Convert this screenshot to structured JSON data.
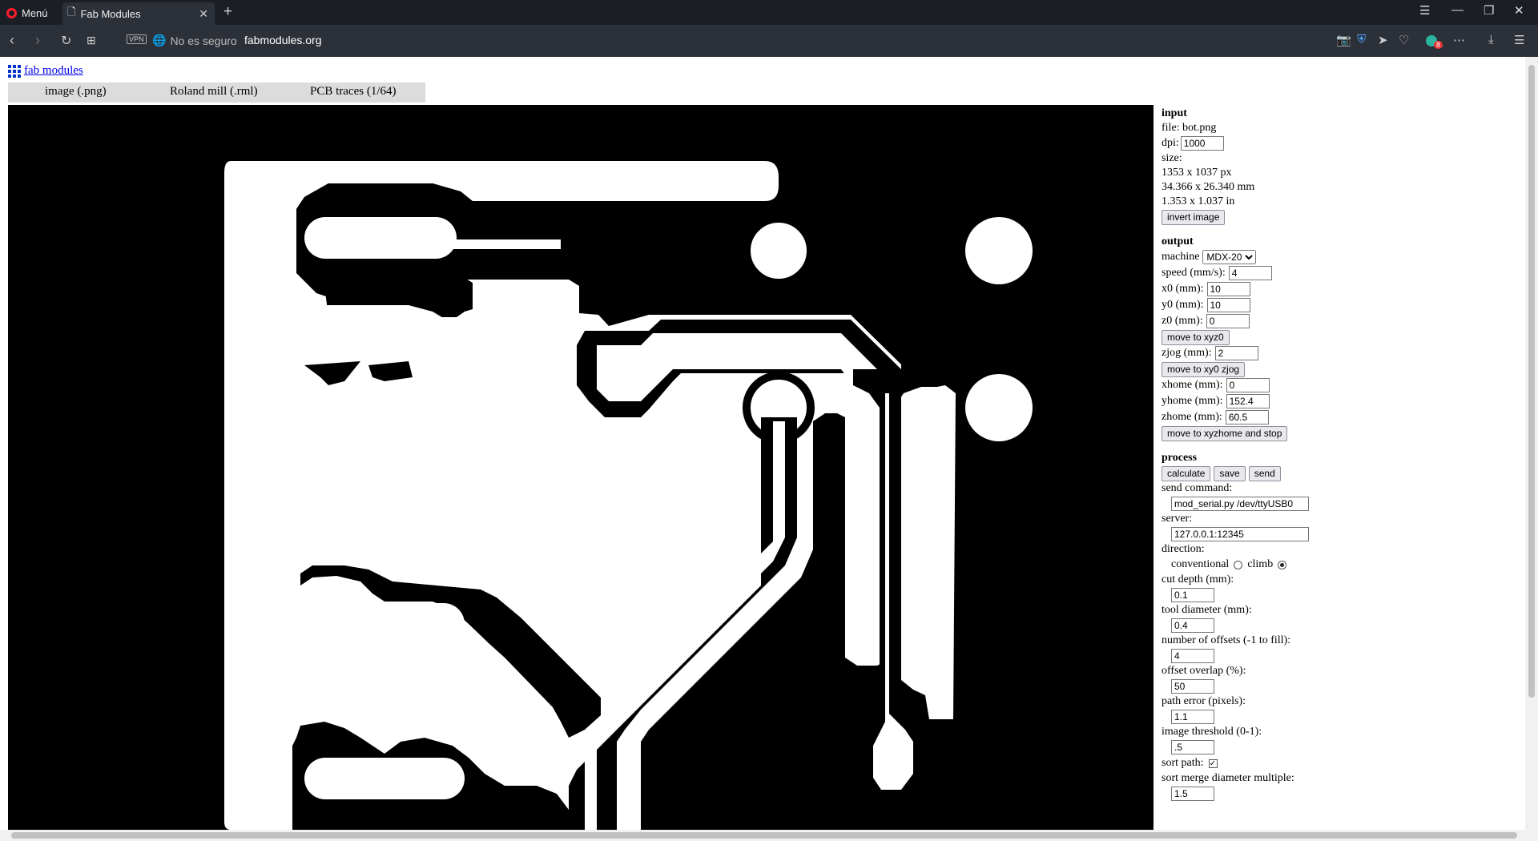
{
  "browser": {
    "menu_label": "Menú",
    "tab_title": "Fab Modules",
    "security_label": "No es seguro",
    "url": "fabmodules.org",
    "vpn_label": "VPN",
    "badge_count": "8",
    "accent_color": "#ff1b2d"
  },
  "page": {
    "logo_link": "fab modules",
    "modules": {
      "input": "image (.png)",
      "output": "Roland mill (.rml)",
      "process": "PCB traces (1/64)"
    }
  },
  "panel": {
    "input": {
      "heading": "input",
      "file": "file: bot.png",
      "dpi_label": "dpi:",
      "dpi_value": "1000",
      "size_label": "size:",
      "size_px": "1353 x 1037 px",
      "size_mm": "34.366 x 26.340 mm",
      "size_in": "1.353 x 1.037 in",
      "invert_button": "invert image"
    },
    "output": {
      "heading": "output",
      "machine_label": "machine",
      "machine_value": "MDX-20",
      "speed_label": "speed (mm/s):",
      "speed_value": "4",
      "x0_label": "x0 (mm):",
      "x0_value": "10",
      "y0_label": "y0 (mm):",
      "y0_value": "10",
      "z0_label": "z0 (mm):",
      "z0_value": "0",
      "move_xyz0_button": "move to xyz0",
      "zjog_label": "zjog (mm):",
      "zjog_value": "2",
      "move_xy0_button": "move to xy0 zjog",
      "xhome_label": "xhome (mm):",
      "xhome_value": "0",
      "yhome_label": "yhome (mm):",
      "yhome_value": "152.4",
      "zhome_label": "zhome (mm):",
      "zhome_value": "60.5",
      "move_home_button": "move to xyzhome and stop"
    },
    "process": {
      "heading": "process",
      "calculate_button": "calculate",
      "save_button": "save",
      "send_button": "send",
      "send_command_label": "send command:",
      "send_command_value": "mod_serial.py /dev/ttyUSB0",
      "server_label": "server:",
      "server_value": "127.0.0.1:12345",
      "direction_label": "direction:",
      "conventional_label": "conventional",
      "climb_label": "climb",
      "direction_selected": "climb",
      "cut_depth_label": "cut depth (mm):",
      "cut_depth_value": "0.1",
      "tool_diameter_label": "tool diameter (mm):",
      "tool_diameter_value": "0.4",
      "offsets_label": "number of offsets (-1 to fill):",
      "offsets_value": "4",
      "overlap_label": "offset overlap (%):",
      "overlap_value": "50",
      "path_error_label": "path error (pixels):",
      "path_error_value": "1.1",
      "threshold_label": "image threshold (0-1):",
      "threshold_value": ".5",
      "sort_path_label": "sort path:",
      "sort_path_checked": true,
      "merge_label": "sort merge diameter multiple:",
      "merge_value": "1.5"
    }
  }
}
